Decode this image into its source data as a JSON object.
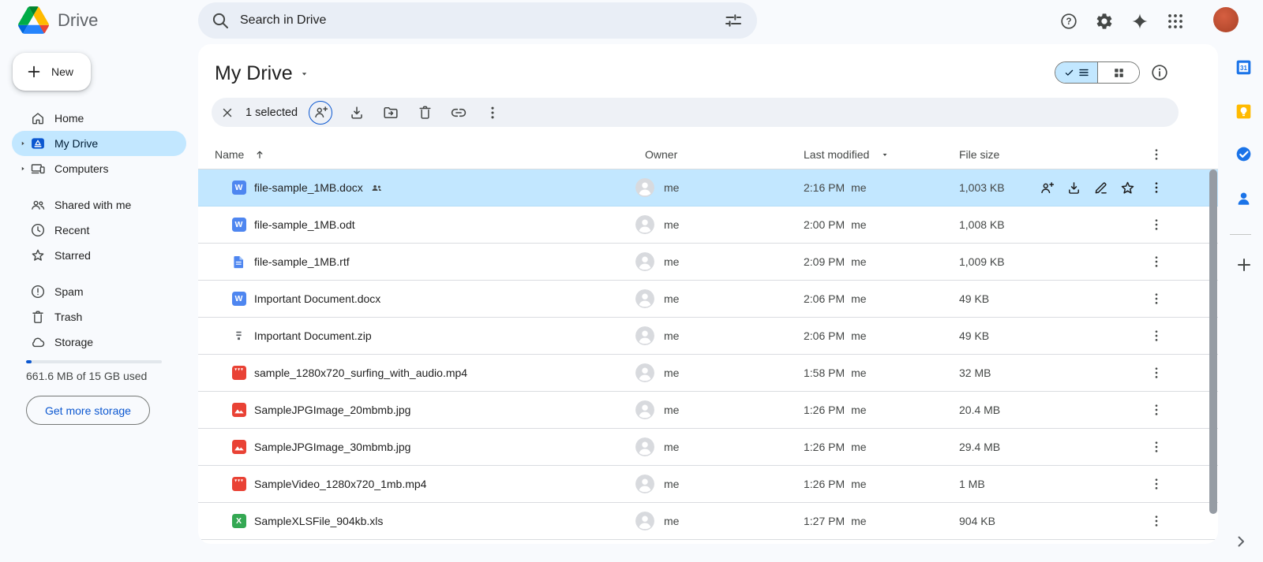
{
  "header": {
    "app_name": "Drive",
    "search_placeholder": "Search in Drive"
  },
  "sidebar": {
    "new_button": "New",
    "items": [
      {
        "label": "Home",
        "icon": "home",
        "caret": false,
        "selected": false
      },
      {
        "label": "My Drive",
        "icon": "drive",
        "caret": true,
        "selected": true
      },
      {
        "label": "Computers",
        "icon": "computers",
        "caret": true,
        "selected": false
      },
      {
        "label": "Shared with me",
        "icon": "people",
        "caret": false,
        "selected": false
      },
      {
        "label": "Recent",
        "icon": "clock",
        "caret": false,
        "selected": false
      },
      {
        "label": "Starred",
        "icon": "star",
        "caret": false,
        "selected": false
      },
      {
        "label": "Spam",
        "icon": "spam",
        "caret": false,
        "selected": false
      },
      {
        "label": "Trash",
        "icon": "trash",
        "caret": false,
        "selected": false
      },
      {
        "label": "Storage",
        "icon": "cloud",
        "caret": false,
        "selected": false
      }
    ],
    "storage": {
      "used_text": "661.6 MB of 15 GB used",
      "percent_used": 4.3,
      "button": "Get more storage"
    }
  },
  "main": {
    "title": "My Drive",
    "toolbar": {
      "selected_count": "1 selected"
    },
    "table": {
      "headers": {
        "name": "Name",
        "owner": "Owner",
        "modified": "Last modified",
        "size": "File size"
      },
      "rows": [
        {
          "name": "file-sample_1MB.docx",
          "type": "docx",
          "shared": true,
          "owner": "me",
          "modified": "2:16 PM",
          "modified_by": "me",
          "size": "1,003 KB",
          "selected": true
        },
        {
          "name": "file-sample_1MB.odt",
          "type": "docx",
          "shared": false,
          "owner": "me",
          "modified": "2:00 PM",
          "modified_by": "me",
          "size": "1,008 KB",
          "selected": false
        },
        {
          "name": "file-sample_1MB.rtf",
          "type": "rtf",
          "shared": false,
          "owner": "me",
          "modified": "2:09 PM",
          "modified_by": "me",
          "size": "1,009 KB",
          "selected": false
        },
        {
          "name": "Important Document.docx",
          "type": "docx",
          "shared": false,
          "owner": "me",
          "modified": "2:06 PM",
          "modified_by": "me",
          "size": "49 KB",
          "selected": false
        },
        {
          "name": "Important Document.zip",
          "type": "zip",
          "shared": false,
          "owner": "me",
          "modified": "2:06 PM",
          "modified_by": "me",
          "size": "49 KB",
          "selected": false
        },
        {
          "name": "sample_1280x720_surfing_with_audio.mp4",
          "type": "video",
          "shared": false,
          "owner": "me",
          "modified": "1:58 PM",
          "modified_by": "me",
          "size": "32 MB",
          "selected": false
        },
        {
          "name": "SampleJPGImage_20mbmb.jpg",
          "type": "image",
          "shared": false,
          "owner": "me",
          "modified": "1:26 PM",
          "modified_by": "me",
          "size": "20.4 MB",
          "selected": false
        },
        {
          "name": "SampleJPGImage_30mbmb.jpg",
          "type": "image",
          "shared": false,
          "owner": "me",
          "modified": "1:26 PM",
          "modified_by": "me",
          "size": "29.4 MB",
          "selected": false
        },
        {
          "name": "SampleVideo_1280x720_1mb.mp4",
          "type": "video",
          "shared": false,
          "owner": "me",
          "modified": "1:26 PM",
          "modified_by": "me",
          "size": "1 MB",
          "selected": false
        },
        {
          "name": "SampleXLSFile_904kb.xls",
          "type": "excel",
          "shared": false,
          "owner": "me",
          "modified": "1:27 PM",
          "modified_by": "me",
          "size": "904 KB",
          "selected": false
        }
      ]
    }
  },
  "side_panel": {
    "calendar_day": "31",
    "icon_names": [
      "calendar-icon",
      "keep-icon",
      "tasks-icon",
      "contacts-icon",
      "plus-icon",
      "chevron-right-icon"
    ]
  },
  "icons": {
    "file_type_letters": {
      "docx": "W",
      "excel": "X"
    },
    "names": [
      "drive-logo-icon",
      "search-icon",
      "filter-options-icon",
      "help-icon",
      "settings-icon",
      "gemini-icon",
      "apps-grid-icon",
      "account-avatar",
      "plus-icon",
      "home-icon",
      "drive-icon",
      "computers-icon",
      "people-icon",
      "clock-icon",
      "star-icon",
      "spam-icon",
      "trash-icon",
      "cloud-icon",
      "close-icon",
      "person-add-icon",
      "download-icon",
      "move-to-folder-icon",
      "link-icon",
      "more-vert-icon",
      "rename-pencil-icon",
      "sort-arrow-up-icon",
      "caret-down-icon",
      "caret-right-icon",
      "check-icon",
      "list-view-icon",
      "grid-view-icon",
      "info-icon",
      "shared-people-icon",
      "owner-avatar"
    ]
  },
  "colors": {
    "accent_blue": "#0b57d0",
    "selection_blue": "#c2e7ff",
    "page_background": "#f8fafd",
    "docs_blue": "#4e86f0",
    "media_red": "#e94235",
    "sheets_green": "#34a853",
    "avatar_orange": "#c0533b"
  }
}
